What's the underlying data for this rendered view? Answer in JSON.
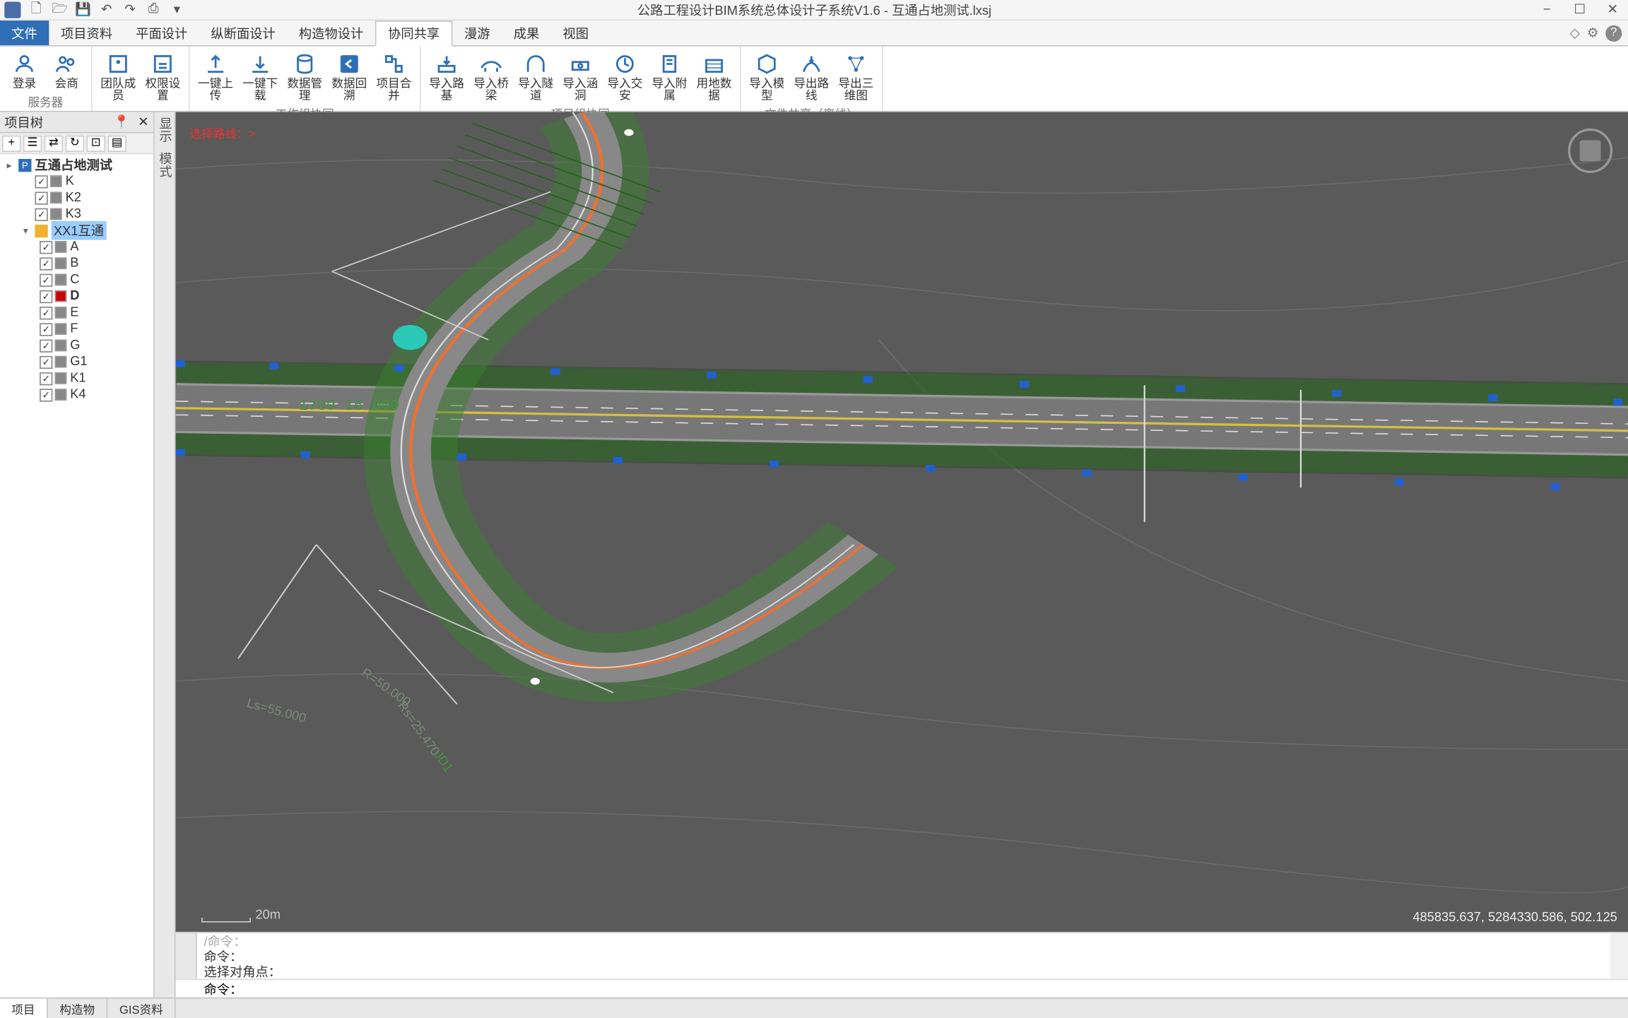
{
  "titlebar": {
    "title": "公路工程设计BIM系统总体设计子系统V1.6 - 互通占地测试.lxsj"
  },
  "tabs": {
    "file": "文件",
    "items": [
      "项目资料",
      "平面设计",
      "纵断面设计",
      "构造物设计",
      "协同共享",
      "漫游",
      "成果",
      "视图"
    ],
    "active_index": 4
  },
  "ribbon": {
    "groups": [
      {
        "label": "服务器",
        "buttons": [
          {
            "label": "登录",
            "icon": "user"
          },
          {
            "label": "会商",
            "icon": "users"
          }
        ]
      },
      {
        "label": "",
        "buttons": [
          {
            "label": "团队成员",
            "icon": "team"
          },
          {
            "label": "权限设置",
            "icon": "gear"
          }
        ]
      },
      {
        "label": "工作组协同",
        "buttons": [
          {
            "label": "一键上传",
            "icon": "upload"
          },
          {
            "label": "一键下载",
            "icon": "download"
          },
          {
            "label": "数据管理",
            "icon": "db"
          },
          {
            "label": "数据回溯",
            "icon": "back"
          },
          {
            "label": "项目合并",
            "icon": "merge"
          }
        ]
      },
      {
        "label": "项目组协同",
        "buttons": [
          {
            "label": "导入路基",
            "icon": "imp"
          },
          {
            "label": "导入桥梁",
            "icon": "imp"
          },
          {
            "label": "导入隧道",
            "icon": "imp"
          },
          {
            "label": "导入涵洞",
            "icon": "imp"
          },
          {
            "label": "导入交安",
            "icon": "imp"
          },
          {
            "label": "导入附属",
            "icon": "imp"
          },
          {
            "label": "用地数据",
            "icon": "land"
          }
        ]
      },
      {
        "label": "文件共享（离线）",
        "buttons": [
          {
            "label": "导入模型",
            "icon": "model"
          },
          {
            "label": "导出路线",
            "icon": "exp"
          },
          {
            "label": "导出三维图",
            "icon": "3d"
          }
        ]
      }
    ]
  },
  "sidebar": {
    "title": "项目树",
    "toolbar_buttons": [
      "+",
      "☰",
      "⇄",
      "↻",
      "⊡",
      "▤"
    ],
    "tree": {
      "root": {
        "label": "互通占地测试",
        "icon": "P"
      },
      "items": [
        {
          "label": "K",
          "checked": true,
          "color": "#888"
        },
        {
          "label": "K2",
          "checked": true,
          "color": "#888"
        },
        {
          "label": "K3",
          "checked": true,
          "color": "#888"
        }
      ],
      "interchange": {
        "label": "XX1互通",
        "selected": true
      },
      "ramps": [
        {
          "label": "A",
          "checked": true,
          "color": "#888"
        },
        {
          "label": "B",
          "checked": true,
          "color": "#888"
        },
        {
          "label": "C",
          "checked": true,
          "color": "#888"
        },
        {
          "label": "D",
          "checked": true,
          "color": "#c00",
          "bold": true
        },
        {
          "label": "E",
          "checked": true,
          "color": "#888"
        },
        {
          "label": "F",
          "checked": true,
          "color": "#888"
        },
        {
          "label": "G",
          "checked": true,
          "color": "#888"
        },
        {
          "label": "G1",
          "checked": true,
          "color": "#888"
        },
        {
          "label": "K1",
          "checked": true,
          "color": "#888"
        },
        {
          "label": "K4",
          "checked": true,
          "color": "#888"
        }
      ]
    }
  },
  "viewport": {
    "overlay": "选择路线：>",
    "scale": "20m",
    "coords": "485835.637, 5284330.586, 502.125",
    "annotations": {
      "station": "1709 16 000",
      "r1": "R=50.000",
      "ls1": "Ls=55.000",
      "rs1": "Rs=25.470",
      "jd1": "JD1"
    }
  },
  "cmd": {
    "line0": "/命令：",
    "line1": "命令：",
    "line2": "选择对角点：",
    "prompt": "命令："
  },
  "bottom_tabs": {
    "items": [
      "项目",
      "构造物",
      "GIS资料"
    ],
    "active_index": 0
  }
}
